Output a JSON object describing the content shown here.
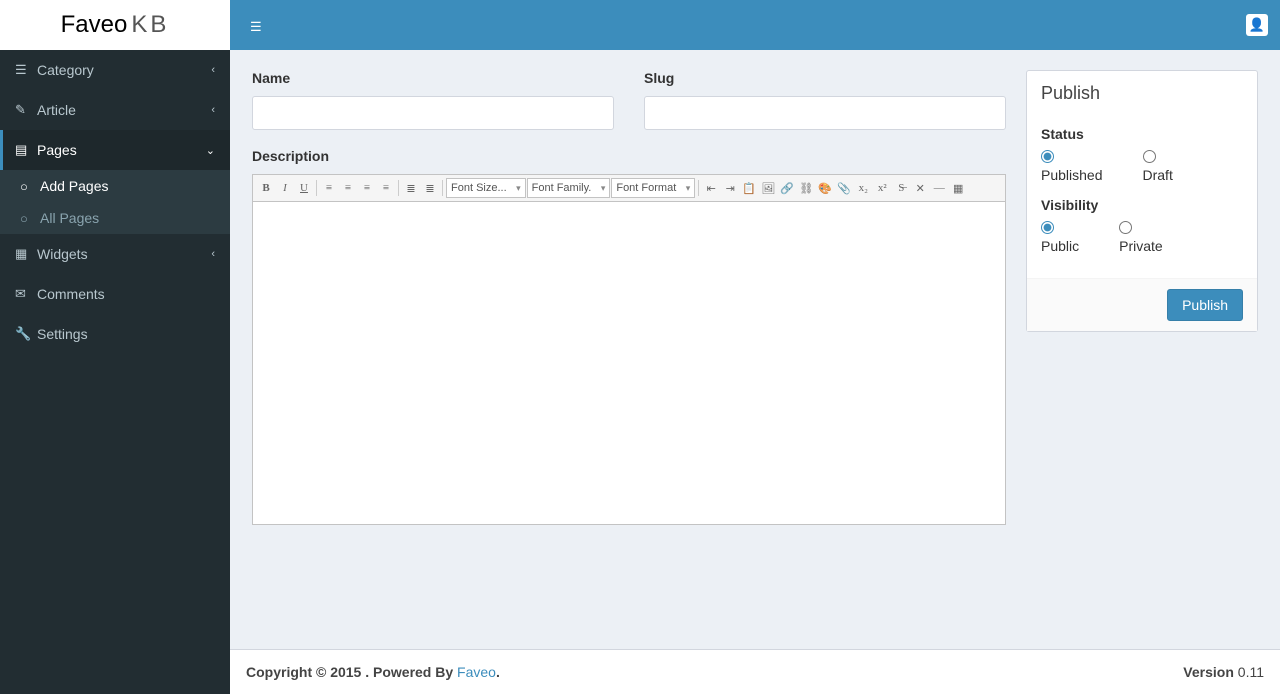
{
  "logo": {
    "main": "Faveo",
    "suffix": "KB"
  },
  "sidebar": {
    "items": [
      {
        "label": "Category",
        "icon": "list-icon"
      },
      {
        "label": "Article",
        "icon": "edit-icon"
      },
      {
        "label": "Pages",
        "icon": "file-icon",
        "children": [
          {
            "label": "Add Pages"
          },
          {
            "label": "All Pages"
          }
        ]
      },
      {
        "label": "Widgets",
        "icon": "grid-icon"
      },
      {
        "label": "Comments",
        "icon": "comment-icon"
      },
      {
        "label": "Settings",
        "icon": "wrench-icon"
      }
    ]
  },
  "form": {
    "name_label": "Name",
    "name_value": "",
    "slug_label": "Slug",
    "slug_value": "",
    "description_label": "Description"
  },
  "editor": {
    "font_size": "Font Size...",
    "font_family": "Font Family.",
    "font_format": "Font Format"
  },
  "publish": {
    "title": "Publish",
    "status_label": "Status",
    "status_opts": {
      "published": "Published",
      "draft": "Draft"
    },
    "visibility_label": "Visibility",
    "visibility_opts": {
      "public": "Public",
      "private": "Private"
    },
    "button": "Publish"
  },
  "footer": {
    "copyright_pre": "Copyright © 2015 . Powered By ",
    "brand": "Faveo",
    "copyright_post": ".",
    "version_label": "Version",
    "version_value": " 0.11"
  }
}
